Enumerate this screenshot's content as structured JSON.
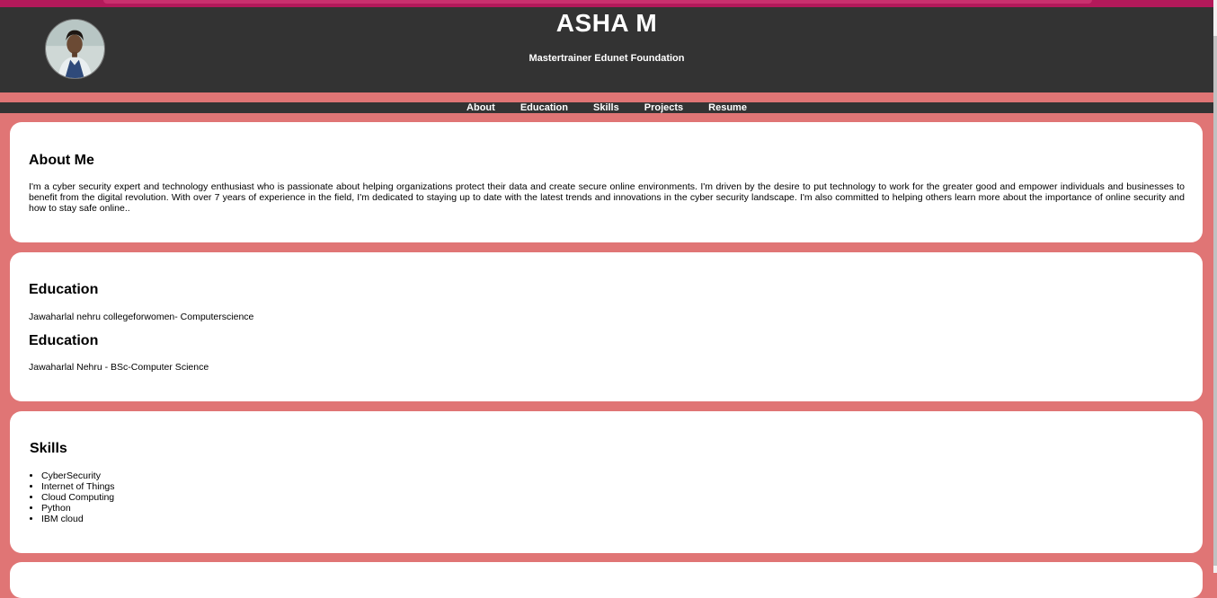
{
  "header": {
    "name": "ASHA M",
    "subtitle": "Mastertrainer Edunet Foundation"
  },
  "nav": {
    "items": [
      "About",
      "Education",
      "Skills",
      "Projects",
      "Resume"
    ]
  },
  "about": {
    "heading": "About Me",
    "text": "I'm a cyber security expert and technology enthusiast who is passionate about helping organizations protect their data and create secure online environments. I'm driven by the desire to put technology to work for the greater good and empower individuals and businesses to benefit from the digital revolution. With over 7 years of experience in the field, I'm dedicated to staying up to date with the latest trends and innovations in the cyber security landscape. I'm also committed to helping others learn more about the importance of online security and how to stay safe online.."
  },
  "education": {
    "entries": [
      {
        "heading": "Education",
        "text": "Jawaharlal nehru collegeforwomen- Computerscience"
      },
      {
        "heading": "Education",
        "text": "Jawaharlal Nehru - BSc-Computer Science"
      }
    ]
  },
  "skills": {
    "heading": "Skills",
    "items": [
      "CyberSecurity",
      "Internet of Things",
      "Cloud Computing",
      "Python",
      "IBM cloud"
    ]
  },
  "colors": {
    "header_bg": "#333333",
    "page_bg": "#e07575",
    "top_strip": "#b3195a",
    "card_bg": "#ffffff"
  }
}
